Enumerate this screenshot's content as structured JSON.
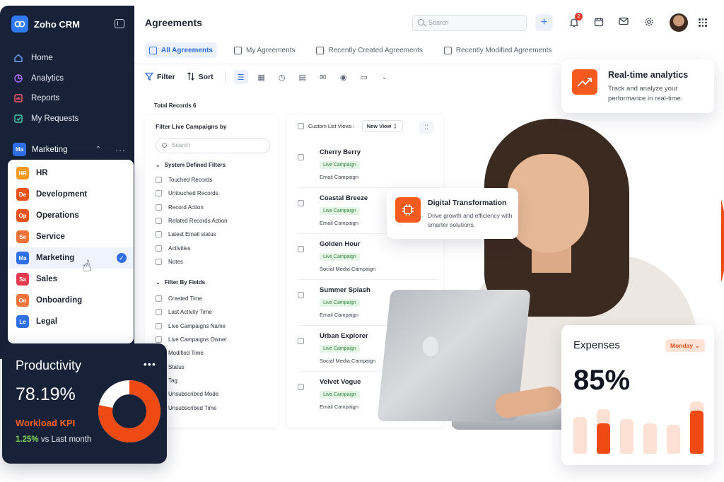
{
  "sidebar": {
    "brand": "Zoho CRM",
    "nav": [
      {
        "label": "Home",
        "icon": "home-icon"
      },
      {
        "label": "Analytics",
        "icon": "analytics-icon"
      },
      {
        "label": "Reports",
        "icon": "reports-icon"
      },
      {
        "label": "My Requests",
        "icon": "requests-icon"
      }
    ],
    "workspace": {
      "badge": "Ma",
      "label": "Marketing"
    }
  },
  "dropdown": {
    "items": [
      {
        "badge": "HR",
        "label": "HR",
        "color": "#f59a1e"
      },
      {
        "badge": "De",
        "label": "Development",
        "color": "#e8531a"
      },
      {
        "badge": "Op",
        "label": "Operations",
        "color": "#e8531a"
      },
      {
        "badge": "Se",
        "label": "Service",
        "color": "#f2743a"
      },
      {
        "badge": "Ma",
        "label": "Marketing",
        "color": "#2f6fe8",
        "active": true
      },
      {
        "badge": "Sa",
        "label": "Sales",
        "color": "#e63b4e"
      },
      {
        "badge": "On",
        "label": "Onboarding",
        "color": "#f2743a"
      },
      {
        "badge": "Le",
        "label": "Legal",
        "color": "#2f6fe8"
      }
    ]
  },
  "header": {
    "title": "Agreements",
    "search_placeholder": "Search",
    "notification_count": "2"
  },
  "tabs": [
    {
      "label": "All Agreements",
      "active": true
    },
    {
      "label": "My Agreements"
    },
    {
      "label": "Recently Created Agreements"
    },
    {
      "label": "Recently Modified Agreements"
    }
  ],
  "toolbar": {
    "filter_label": "Filter",
    "sort_label": "Sort"
  },
  "records": {
    "total_label": "Total Records 6"
  },
  "filters": {
    "title": "Filter Live Campaigns by",
    "search_placeholder": "Search",
    "system_section": "System Defined Filters",
    "system_items": [
      "Touched Records",
      "Untouched Records",
      "Record Action",
      "Related Records Action",
      "Latest Email status",
      "Activities",
      "Notes"
    ],
    "fields_section": "Filter By Fields",
    "field_items": [
      "Created Time",
      "Last Activity Time",
      "Live Campaigns Name",
      "Live Campaigns Owner",
      "Modified Time",
      "Status",
      "Tag",
      "Unsubscribed Mode",
      "Unsubscribed Time"
    ]
  },
  "list_view": {
    "custom_label": "Custom List Views :",
    "new_view_label": "New View",
    "campaigns": [
      {
        "name": "Cherry Berry",
        "tag": "Live Campaign",
        "type": "Email Campaign"
      },
      {
        "name": "Coastal Breeze",
        "tag": "Live Campaign",
        "type": "Email Campaign"
      },
      {
        "name": "Golden Hour",
        "tag": "Live Campaign",
        "type": "Social Media Campaign"
      },
      {
        "name": "Summer Splash",
        "tag": "Live Campaign",
        "type": "Email Campaign"
      },
      {
        "name": "Urban Explorer",
        "tag": "Live Campaign",
        "type": "Social Media Campaign"
      },
      {
        "name": "Velvet Vogue",
        "tag": "Live Campaign",
        "type": "Email Campaign"
      }
    ]
  },
  "cards": {
    "realtime": {
      "title": "Real-time analytics",
      "desc": "Track and analyze your performance in real-time."
    },
    "digital": {
      "title": "Digital Transformation",
      "desc": "Drive growth and efficiency with smarter solutions."
    },
    "expenses": {
      "title": "Expenses",
      "period": "Monday",
      "value": "85%",
      "bars": [
        {
          "bg": 0.7,
          "fg": 0
        },
        {
          "bg": 0.85,
          "fg": 0.58
        },
        {
          "bg": 0.66,
          "fg": 0
        },
        {
          "bg": 0.58,
          "fg": 0
        },
        {
          "bg": 0.56,
          "fg": 0
        },
        {
          "bg": 1.0,
          "fg": 0.82
        }
      ]
    },
    "productivity": {
      "title": "Productivity",
      "value": "78.19%",
      "kpi": "Workload KPI",
      "change_pct": "1.25%",
      "change_text": "vs Last month",
      "donut_fraction": 0.7819
    }
  },
  "colors": {
    "accent": "#2f6fe8",
    "brand_orange": "#f04a14",
    "navy": "#172239"
  }
}
